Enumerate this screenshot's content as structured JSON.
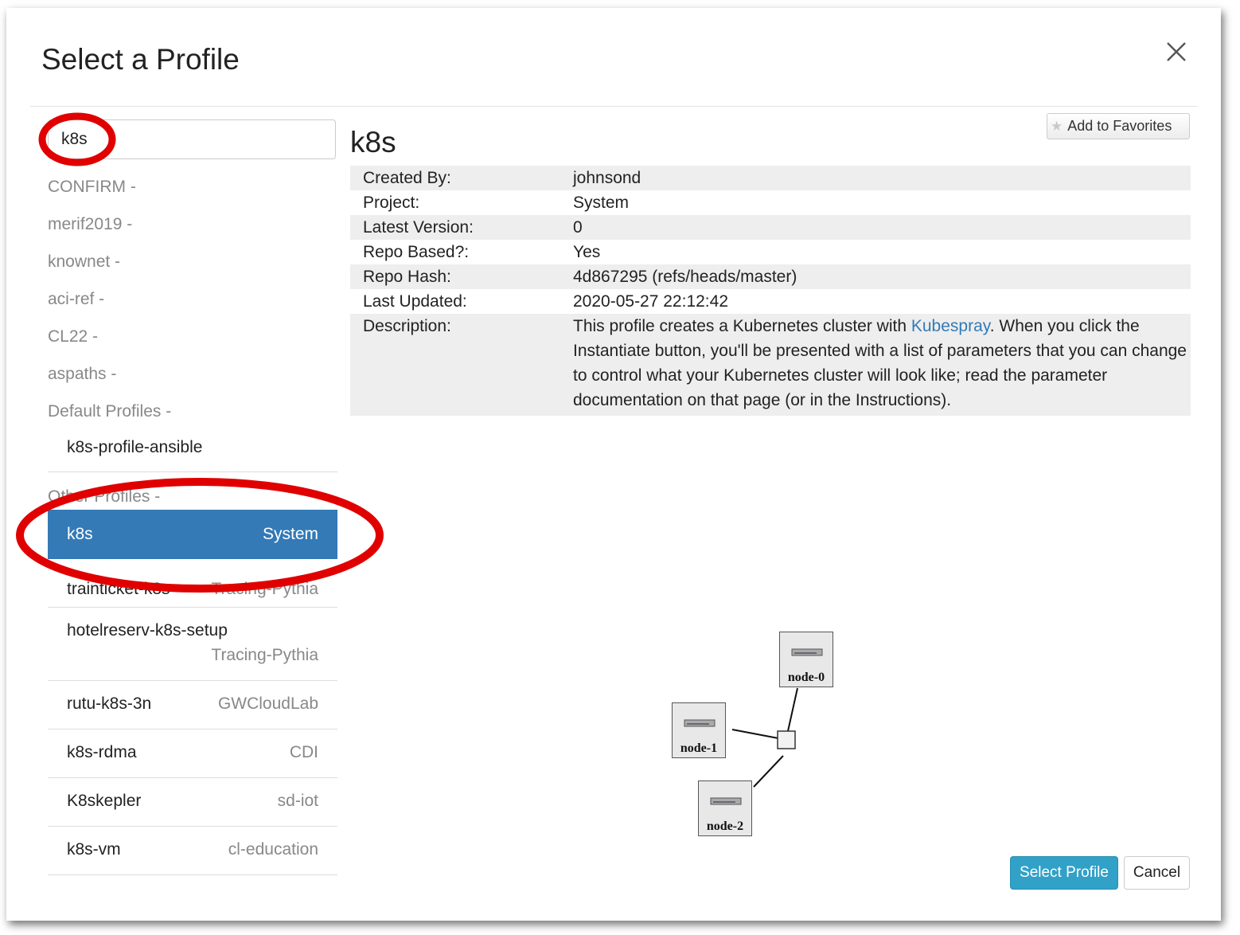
{
  "dialog": {
    "title": "Select a Profile"
  },
  "search": {
    "value": "k8s"
  },
  "groups": [
    {
      "label": "CONFIRM -"
    },
    {
      "label": "merif2019 -"
    },
    {
      "label": "knownet -"
    },
    {
      "label": "aci-ref -"
    },
    {
      "label": "CL22 -"
    },
    {
      "label": "aspaths -"
    },
    {
      "label": "Default Profiles -"
    },
    {
      "label": "Other Profiles -"
    }
  ],
  "default_profiles": [
    {
      "name": "k8s-profile-ansible"
    }
  ],
  "other_profiles": [
    {
      "name": "k8s",
      "project": "System",
      "selected": true
    },
    {
      "name": "trainticket-k8s",
      "project": "Tracing-Pythia"
    },
    {
      "name": "hotelreserv-k8s-setup",
      "project": "Tracing-Pythia"
    },
    {
      "name": "rutu-k8s-3n",
      "project": "GWCloudLab"
    },
    {
      "name": "k8s-rdma",
      "project": "CDI"
    },
    {
      "name": "K8skepler",
      "project": "sd-iot"
    },
    {
      "name": "k8s-vm",
      "project": "cl-education"
    }
  ],
  "detail": {
    "favorites_label": "Add to Favorites",
    "profile_title": "k8s",
    "fields": [
      {
        "key": "Created By:",
        "value": "johnsond"
      },
      {
        "key": "Project:",
        "value": "System"
      },
      {
        "key": "Latest Version:",
        "value": "0"
      },
      {
        "key": "Repo Based?:",
        "value": "Yes"
      },
      {
        "key": "Repo Hash:",
        "value": "4d867295 (refs/heads/master)"
      },
      {
        "key": "Last Updated:",
        "value": "2020-05-27 22:12:42"
      }
    ],
    "description": {
      "key": "Description:",
      "before": "This profile creates a Kubernetes cluster with ",
      "link": "Kubespray",
      "after": ". When you click the Instantiate button, you'll be presented with a list of parameters that you can change to control what your Kubernetes cluster will look like; read the parameter documentation on that page (or in the Instructions)."
    }
  },
  "topology": {
    "nodes": [
      {
        "label": "node-0"
      },
      {
        "label": "node-1"
      },
      {
        "label": "node-2"
      }
    ]
  },
  "buttons": {
    "select": "Select Profile",
    "cancel": "Cancel"
  },
  "colors": {
    "selected_row": "#337ab7",
    "primary_button": "#31a1c8",
    "annotation": "#e00000"
  }
}
